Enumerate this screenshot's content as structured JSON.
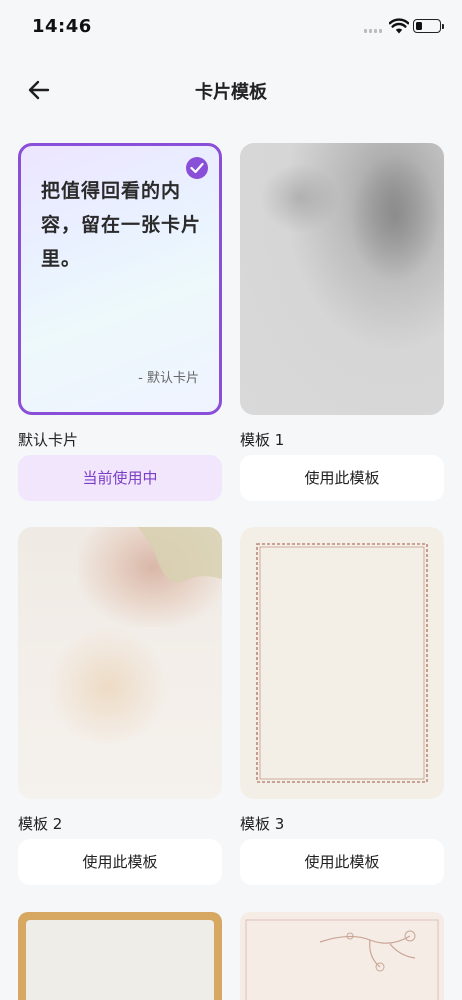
{
  "status_bar": {
    "time": "14:46"
  },
  "header": {
    "title": "卡片模板",
    "back_icon": "arrow-left-icon"
  },
  "templates": [
    {
      "name": "默认卡片",
      "button_label": "当前使用中",
      "selected": true,
      "preview_text": "把值得回看的内容，留在一张卡片里。",
      "preview_attribution": "- 默认卡片"
    },
    {
      "name": "模板 1",
      "button_label": "使用此模板",
      "selected": false
    },
    {
      "name": "模板 2",
      "button_label": "使用此模板",
      "selected": false
    },
    {
      "name": "模板 3",
      "button_label": "使用此模板",
      "selected": false
    }
  ],
  "colors": {
    "accent": "#8a4fd8",
    "accent_bg": "#f1e6fb",
    "background": "#f6f7f9"
  }
}
